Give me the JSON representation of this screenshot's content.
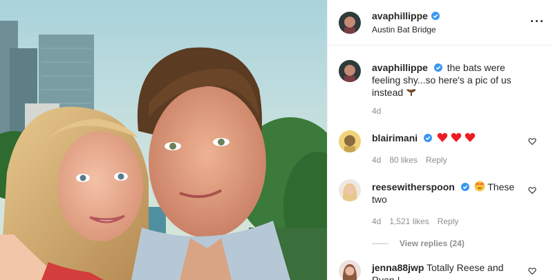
{
  "post": {
    "username": "avaphillippe",
    "location": "Austin Bat Bridge",
    "more_icon": "more-horizontal-icon"
  },
  "caption": {
    "username": "avaphillippe",
    "text": "the bats were feeling shy...so here's a pic of us instead",
    "time": "4d"
  },
  "comments": [
    {
      "username": "blairimani",
      "verified": true,
      "text": "",
      "emoji": "red-hearts",
      "time": "4d",
      "likes": "80 likes",
      "reply": "Reply"
    },
    {
      "username": "reesewitherspoon",
      "verified": true,
      "text": "These two",
      "emoji": "heart-eyes",
      "time": "4d",
      "likes": "1,521 likes",
      "reply": "Reply",
      "view_replies": "View replies (24)"
    },
    {
      "username": "jenna88jwp",
      "verified": false,
      "text": "Totally Reese and Ryan !",
      "more": "..."
    }
  ],
  "colors": {
    "verified_blue": "#3897f0",
    "meta_gray": "#8e8e8e",
    "heart_red": "#ed1c24"
  }
}
